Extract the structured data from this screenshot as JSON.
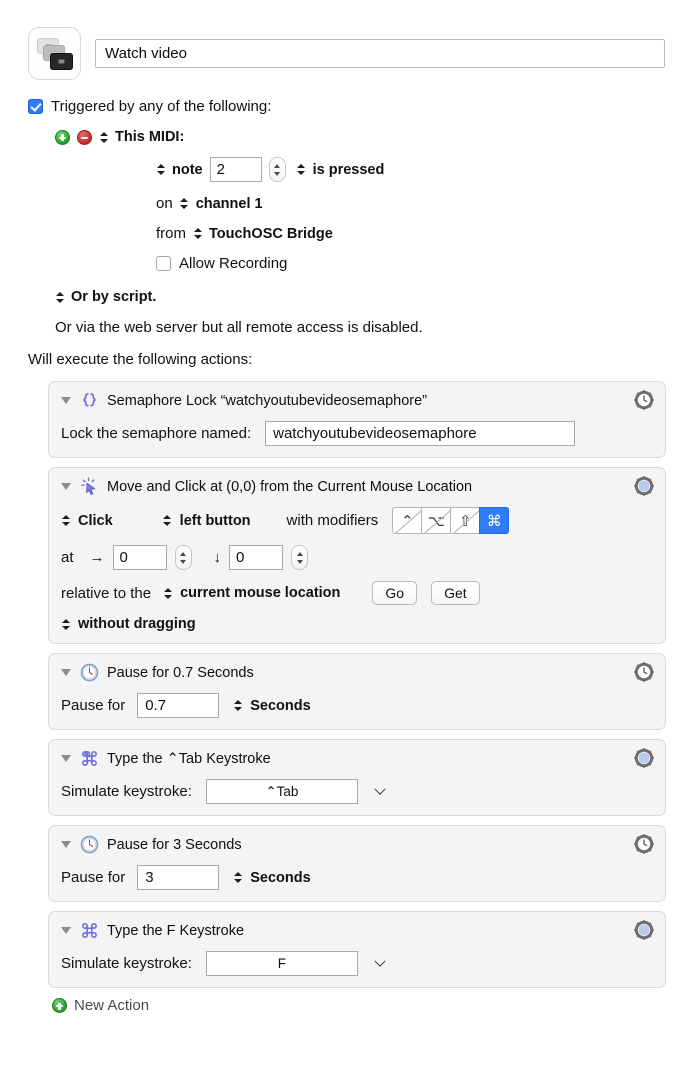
{
  "macro": {
    "icon_name": "macro-stack-icon",
    "title": "Watch video"
  },
  "trigger": {
    "enabled": true,
    "header_label": "Triggered by any of the following:",
    "add_button": "+",
    "remove_button": "−",
    "type_label": "This MIDI:",
    "event_label": "note",
    "note_value": "2",
    "state_label": "is pressed",
    "on_label": "on",
    "channel_label": "channel 1",
    "from_label": "from",
    "device_label": "TouchOSC Bridge",
    "allow_recording_label": "Allow Recording",
    "allow_recording_checked": false,
    "script_label": "Or by script.",
    "web_server_label": "Or via the web server but all remote access is disabled.",
    "actions_intro": "Will execute the following actions:"
  },
  "actions": [
    {
      "icon_name": "curly-braces-icon",
      "gear_name": "gear-clock-icon",
      "title": "Semaphore Lock “watchyoutubevideosemaphore”",
      "field_label": "Lock the semaphore named:",
      "field_value": "watchyoutubevideosemaphore"
    },
    {
      "icon_name": "mouse-click-icon",
      "gear_name": "gear-blue-icon",
      "title": "Move and Click at (0,0) from the Current Mouse Location",
      "click_action": "Click",
      "mouse_button": "left button",
      "modifiers_label": "with modifiers",
      "modifiers": [
        {
          "name": "control-modifier",
          "glyph": "⌃",
          "active": false
        },
        {
          "name": "option-modifier",
          "glyph": "⌥",
          "active": false
        },
        {
          "name": "shift-modifier",
          "glyph": "⇧",
          "active": false
        },
        {
          "name": "command-modifier",
          "glyph": "⌘",
          "active": true
        }
      ],
      "at_label": "at",
      "x_arrow": "→",
      "x_value": "0",
      "y_arrow": "↓",
      "y_value": "0",
      "relative_label": "relative to the",
      "relative_target": "current mouse location",
      "go_button": "Go",
      "get_button": "Get",
      "drag_label": "without dragging"
    },
    {
      "icon_name": "clock-icon",
      "gear_name": "gear-clock-icon",
      "title": "Pause for 0.7 Seconds",
      "field_label": "Pause for",
      "field_value": "0.7",
      "unit_label": "Seconds"
    },
    {
      "icon_name": "command-key-icon",
      "gear_name": "gear-blue-icon",
      "title": "Type the ⌃Tab Keystroke",
      "field_label": "Simulate keystroke:",
      "field_value": "⌃Tab"
    },
    {
      "icon_name": "clock-icon",
      "gear_name": "gear-clock-icon",
      "title": "Pause for 3 Seconds",
      "field_label": "Pause for",
      "field_value": "3",
      "unit_label": "Seconds"
    },
    {
      "icon_name": "command-key-icon",
      "gear_name": "gear-blue-icon",
      "title": "Type the F Keystroke",
      "field_label": "Simulate keystroke:",
      "field_value": "F"
    }
  ],
  "new_action": {
    "label": "New Action"
  },
  "colors": {
    "accent_blue": "#2f7cf6",
    "icon_purple": "#6b6fe0",
    "add_green": "#239a2e",
    "remove_red": "#c0242a",
    "panel_bg": "#f4f4f4"
  }
}
